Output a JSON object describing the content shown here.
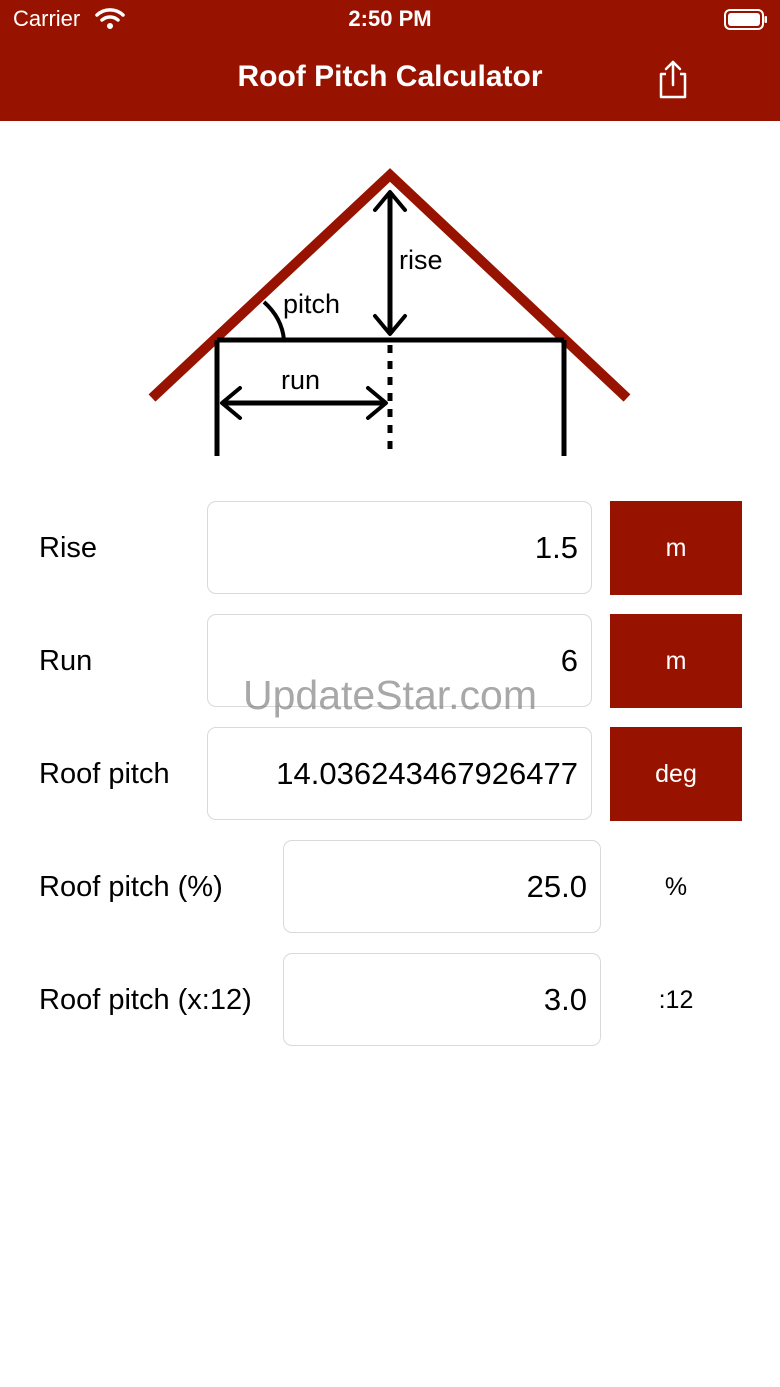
{
  "status_bar": {
    "carrier": "Carrier",
    "time": "2:50 PM"
  },
  "header": {
    "title": "Roof Pitch Calculator",
    "share_icon": "share-icon"
  },
  "diagram": {
    "rise_label": "rise",
    "pitch_label": "pitch",
    "run_label": "run"
  },
  "rows": [
    {
      "label": "Rise",
      "value": "1.5",
      "unit": "m"
    },
    {
      "label": "Run",
      "value": "6",
      "unit": "m"
    },
    {
      "label": "Roof pitch",
      "value": "14.036243467926477",
      "unit": "deg"
    },
    {
      "label": "Roof pitch (%)",
      "value": "25.0",
      "unit": "%"
    },
    {
      "label": "Roof pitch (x:12)",
      "value": "3.0",
      "unit": ":12"
    }
  ],
  "watermark": "UpdateStar.com",
  "colors": {
    "accent": "#981200",
    "background": "#ffffff",
    "field_border": "#d9d9d9"
  }
}
